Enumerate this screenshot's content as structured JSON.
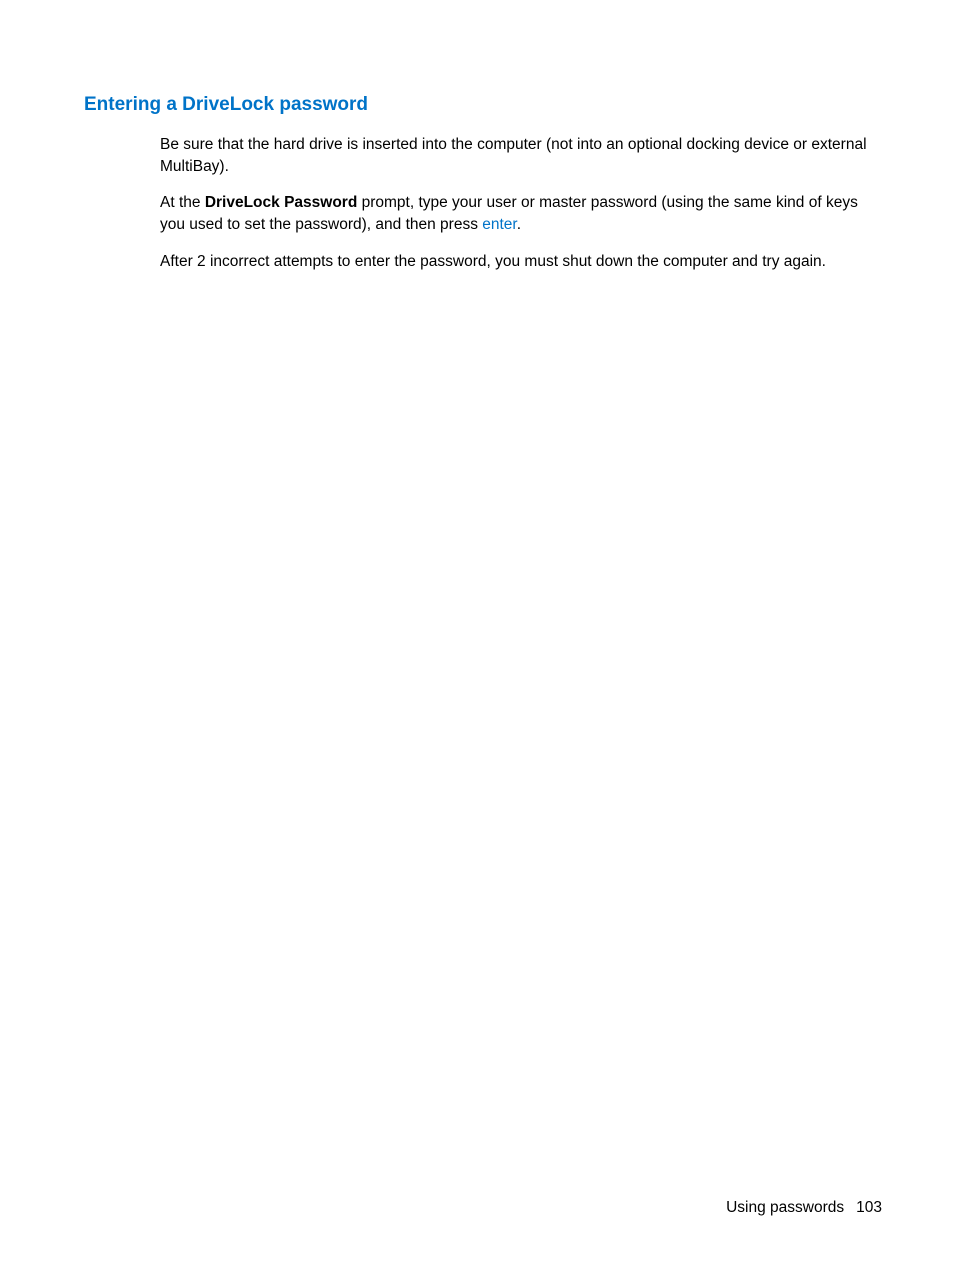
{
  "heading": "Entering a DriveLock password",
  "paragraph1": "Be sure that the hard drive is inserted into the computer (not into an optional docking device or external MultiBay).",
  "paragraph2_prefix": "At the ",
  "paragraph2_bold": "DriveLock Password",
  "paragraph2_middle": " prompt, type your user or master password (using the same kind of keys you used to set the password), and then press ",
  "paragraph2_link": "enter",
  "paragraph2_suffix": ".",
  "paragraph3": "After 2 incorrect attempts to enter the password, you must shut down the computer and try again.",
  "footer_title": "Using passwords",
  "footer_page": "103"
}
